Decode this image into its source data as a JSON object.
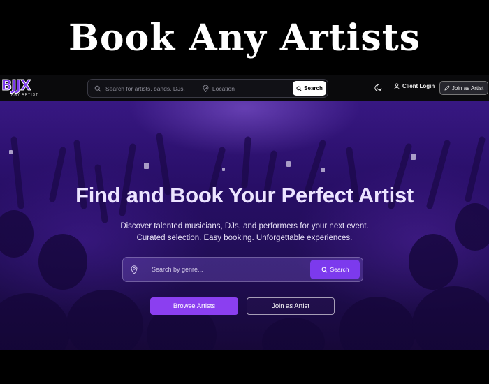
{
  "banner": {
    "title": "Book Any Artists"
  },
  "logo": {
    "mark": "BJJX",
    "sub": "ANY ARTIST"
  },
  "navbar": {
    "search_placeholder": "Search for artists, bands, DJs.",
    "location_placeholder": "Location",
    "search_button": "Search",
    "client_login": "Client Login",
    "join_button": "Join as Artist"
  },
  "hero": {
    "headline": "Find and Book Your Perfect Artist",
    "subline_1": "Discover talented musicians, DJs, and performers for your next event.",
    "subline_2": "Curated selection. Easy booking. Unforgettable experiences.",
    "search_placeholder": "Search by genre...",
    "search_button": "Search",
    "browse_button": "Browse Artists",
    "join_button": "Join as Artist"
  },
  "colors": {
    "accent": "#7c3aed",
    "background": "#000000"
  },
  "icons": [
    "search-icon",
    "location-pin-icon",
    "moon-icon",
    "user-icon",
    "pen-icon"
  ]
}
